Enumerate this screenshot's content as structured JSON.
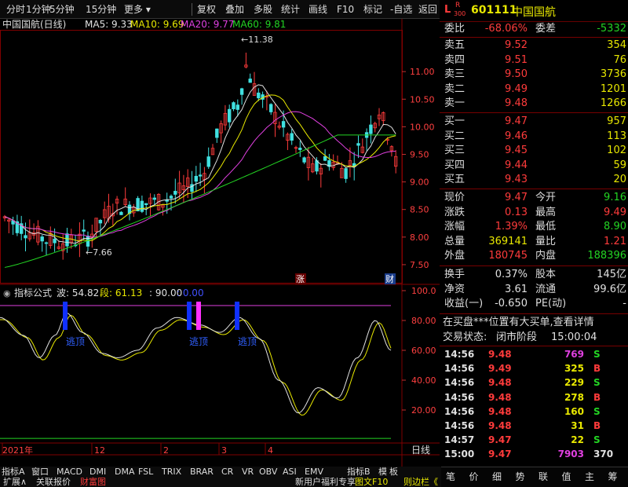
{
  "toolbar": {
    "items": [
      "分时",
      "1分钟",
      "5分钟",
      "15分钟",
      "更多",
      "复权",
      "叠加",
      "多股",
      "统计",
      "画线",
      "F10",
      "标记",
      "-自选",
      "返回"
    ]
  },
  "stock": {
    "market_badge": "L",
    "code": "601111",
    "name": "中国国航",
    "r_label": "R",
    "r_sub": "300"
  },
  "chart": {
    "title": "中国国航(日线)",
    "ma": [
      {
        "label": "MA5: 9.33",
        "color": "#e0e0e0"
      },
      {
        "label": "MA10: 9.69",
        "color": "#e8e800"
      },
      {
        "label": "MA20: 9.77",
        "color": "#e040e0"
      },
      {
        "label": "MA60: 9.81",
        "color": "#23d423"
      }
    ],
    "price_ticks": [
      "11.00",
      "10.50",
      "10.00",
      "9.50",
      "9.00",
      "8.50",
      "8.00",
      "7.50"
    ],
    "high_label": "11.38",
    "low_label": "7.66",
    "badge_zhang": "涨",
    "badge_cai": "财",
    "indicator": {
      "name": "指标公式",
      "wave_label": "波: 54.82",
      "seg_label": "段: 61.13",
      "third": ": 90.00",
      "fourth": ": 0.00",
      "ticks": [
        "100.0",
        "80.00",
        "60.00",
        "40.00",
        "20.00"
      ],
      "signals": [
        "逃顶",
        "逃顶",
        "逃顶"
      ]
    },
    "date_labels": [
      "2021年",
      "12",
      "2",
      "3",
      "4"
    ],
    "period": "日线"
  },
  "chart_data": {
    "type": "candlestick",
    "ylim": [
      7.2,
      11.7
    ],
    "high": 11.38,
    "low": 7.66,
    "ma": {
      "MA5": 9.33,
      "MA10": 9.69,
      "MA20": 9.77,
      "MA60": 9.81
    },
    "indicator_ylim": [
      0,
      100
    ],
    "indicator_level": 90
  },
  "quote": {
    "weibi": {
      "label": "委比",
      "value": "-68.06%",
      "label2": "委差",
      "value2": "-5332"
    },
    "sells": [
      {
        "label": "卖五",
        "price": "9.52",
        "vol": "354"
      },
      {
        "label": "卖四",
        "price": "9.51",
        "vol": "76"
      },
      {
        "label": "卖三",
        "price": "9.50",
        "vol": "3736"
      },
      {
        "label": "卖二",
        "price": "9.49",
        "vol": "1201"
      },
      {
        "label": "卖一",
        "price": "9.48",
        "vol": "1266"
      }
    ],
    "buys": [
      {
        "label": "买一",
        "price": "9.47",
        "vol": "957"
      },
      {
        "label": "买二",
        "price": "9.46",
        "vol": "113"
      },
      {
        "label": "买三",
        "price": "9.45",
        "vol": "102"
      },
      {
        "label": "买四",
        "price": "9.44",
        "vol": "59"
      },
      {
        "label": "买五",
        "price": "9.43",
        "vol": "20"
      }
    ],
    "stats": [
      {
        "l1": "现价",
        "v1": "9.47",
        "c1": "red",
        "l2": "今开",
        "v2": "9.16",
        "c2": "grn"
      },
      {
        "l1": "涨跌",
        "v1": "0.13",
        "c1": "red",
        "l2": "最高",
        "v2": "9.49",
        "c2": "red"
      },
      {
        "l1": "涨幅",
        "v1": "1.39%",
        "c1": "red",
        "l2": "最低",
        "v2": "8.90",
        "c2": "grn"
      },
      {
        "l1": "总量",
        "v1": "369141",
        "c1": "yel",
        "l2": "量比",
        "v2": "1.21",
        "c2": "red"
      },
      {
        "l1": "外盘",
        "v1": "180745",
        "c1": "red",
        "l2": "内盘",
        "v2": "188396",
        "c2": "grn"
      }
    ],
    "fund": [
      {
        "l1": "换手",
        "v1": "0.37%",
        "l2": "股本",
        "v2": "145亿"
      },
      {
        "l1": "净资",
        "v1": "3.61",
        "l2": "流通",
        "v2": "99.6亿"
      },
      {
        "l1": "收益(一)",
        "v1": "-0.650",
        "l2": "PE(动)",
        "v2": "-"
      }
    ],
    "alert": "在买盘***位置有大买单,查看详情",
    "status_label": "交易状态:",
    "status_value": "闭市阶段",
    "status_time": "15:00:04",
    "ticks": [
      {
        "time": "14:56",
        "price": "9.48",
        "vol": "769",
        "vc": "mag",
        "flag": "S",
        "fc": "grn"
      },
      {
        "time": "14:56",
        "price": "9.49",
        "vol": "325",
        "vc": "yel",
        "flag": "B",
        "fc": "red"
      },
      {
        "time": "14:56",
        "price": "9.48",
        "vol": "229",
        "vc": "yel",
        "flag": "S",
        "fc": "grn"
      },
      {
        "time": "14:56",
        "price": "9.48",
        "vol": "278",
        "vc": "yel",
        "flag": "B",
        "fc": "red"
      },
      {
        "time": "14:56",
        "price": "9.48",
        "vol": "160",
        "vc": "yel",
        "flag": "S",
        "fc": "grn"
      },
      {
        "time": "14:56",
        "price": "9.48",
        "vol": "31",
        "vc": "yel",
        "flag": "B",
        "fc": "red"
      },
      {
        "time": "14:57",
        "price": "9.47",
        "vol": "22",
        "vc": "yel",
        "flag": "S",
        "fc": "grn"
      },
      {
        "time": "15:00",
        "price": "9.47",
        "vol": "7903",
        "vc": "mag",
        "flag": "370",
        "fc": "wht"
      }
    ]
  },
  "bottom": {
    "tabs": [
      "指标A",
      "窗口",
      "MACD",
      "DMI",
      "DMA",
      "FSL",
      "TRIX",
      "BRAR",
      "CR",
      "VR",
      "OBV",
      "ASI",
      "EMV"
    ],
    "tabs_right": [
      "指标B",
      "模",
      "板"
    ],
    "row2": [
      "扩展∧",
      "关联报价",
      "财富图"
    ],
    "row2_right": [
      "新用户福利专享",
      "图文F10",
      "则边栏《"
    ],
    "right_tabs": [
      "笔",
      "价",
      "细",
      "势",
      "联",
      "值",
      "主",
      "筹"
    ]
  }
}
